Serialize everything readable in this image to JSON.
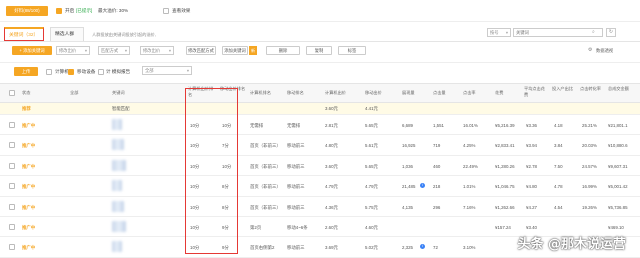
{
  "topbar": {
    "badge": "好料(88/100)",
    "enable_label": "开启",
    "enable_status": "[已提示]",
    "max_label": "最大溢价: 30%",
    "effect_label": "查看效果"
  },
  "tabs": [
    {
      "label": "关键词（32）",
      "active": true
    },
    {
      "label": "精选人群",
      "active": false
    }
  ],
  "tab_hint": "人群投放由关键词投放引起的溢价,",
  "search": {
    "scope": "按号",
    "placeholder": "关键词",
    "download_label": "数据透视"
  },
  "toolbar": {
    "add_keyword": "+ 添加关键词",
    "sel1": "修改出价",
    "sel2": "匹配方式",
    "sel3": "修改出价",
    "btn_smart": "修改匹配方式",
    "btn_add": "添加关键词",
    "btn_delete": "删除",
    "btn_copy": "复制",
    "btn_label": "标签"
  },
  "filters": {
    "upload": "上传",
    "compute": "计算机",
    "device": "移动设备",
    "period_label": "计 模拟报告",
    "period_value": "全部"
  },
  "headers": {
    "status": "状态",
    "all": "全部",
    "keyword": "关键词",
    "pc_rank": "计算机出价排名",
    "mobile_rank": "移动出价排名",
    "pc_match": "计算机排名",
    "mobile_match": "移动排名",
    "pc_bid": "计算机出价",
    "mobile_bid": "移动出价",
    "impressions": "展现量",
    "clicks": "点击量",
    "ctr": "点击率",
    "cost": "花费",
    "avg_cpc": "平均点击花费",
    "input_output": "投入产出比",
    "conv_rate": "点击转化率",
    "total_amount": "总成交金额"
  },
  "summary": {
    "status": "推荐",
    "match": "智能匹配",
    "pc_bid": "3.60元",
    "mobile_bid": "4.41元"
  },
  "rows": [
    {
      "status": "推广中",
      "pc_rank": "10分",
      "mobile_rank": "10分",
      "pc_match": "无需排",
      "mobile_match": "无需排",
      "pc_bid": "2.81元",
      "mobile_bid": "5.65元",
      "impressions": "6,689",
      "clicks": "1,551",
      "ctr": "16.01%",
      "cost": "¥5,216.39",
      "avg_cpc": "¥3.36",
      "roi": "4.18",
      "conv": "25.21%",
      "amount": "¥21,801.1",
      "info": false
    },
    {
      "status": "推广中",
      "pc_rank": "10分",
      "mobile_rank": "7分",
      "pc_match": "首页（非前三）",
      "mobile_match": "移动前三",
      "pc_bid": "4.80元",
      "mobile_bid": "5.61元",
      "impressions": "16,925",
      "clicks": "719",
      "ctr": "4.25%",
      "cost": "¥2,833.41",
      "avg_cpc": "¥3.94",
      "roi": "3.84",
      "conv": "20.03%",
      "amount": "¥10,880.6",
      "info": false
    },
    {
      "status": "推广中",
      "pc_rank": "10分",
      "mobile_rank": "10分",
      "pc_match": "首页（非前三）",
      "mobile_match": "移动前三",
      "pc_bid": "3.60元",
      "mobile_bid": "5.65元",
      "impressions": "1,036",
      "clicks": "460",
      "ctr": "22.49%",
      "cost": "¥1,280.26",
      "avg_cpc": "¥2.78",
      "roi": "7.50",
      "conv": "24.57%",
      "amount": "¥9,607.31",
      "info": false
    },
    {
      "status": "推广中",
      "pc_rank": "10分",
      "mobile_rank": "8分",
      "pc_match": "首页（非前三）",
      "mobile_match": "移动前三",
      "pc_bid": "4.79元",
      "mobile_bid": "4.79元",
      "impressions": "21,485",
      "clicks": "218",
      "ctr": "1.01%",
      "cost": "¥1,046.75",
      "avg_cpc": "¥4.80",
      "roi": "4.78",
      "conv": "16.99%",
      "amount": "¥5,001.42",
      "info": true
    },
    {
      "status": "推广中",
      "pc_rank": "10分",
      "mobile_rank": "8分",
      "pc_match": "首页（非前三）",
      "mobile_match": "移动前三",
      "pc_bid": "4.36元",
      "mobile_bid": "5.75元",
      "impressions": "4,135",
      "clicks": "296",
      "ctr": "7.16%",
      "cost": "¥1,262.66",
      "avg_cpc": "¥4.27",
      "roi": "4.54",
      "conv": "19.26%",
      "amount": "¥5,736.85",
      "info": false
    },
    {
      "status": "推广中",
      "pc_rank": "10分",
      "mobile_rank": "9分",
      "pc_match": "第2页",
      "mobile_match": "移动4~6条",
      "pc_bid": "2.60元",
      "mobile_bid": "4.60元",
      "impressions": "",
      "clicks": "",
      "ctr": "",
      "cost": "¥157.24",
      "avg_cpc": "¥3.40",
      "roi": "",
      "conv": "",
      "amount": "¥469.10",
      "info": false
    },
    {
      "status": "推广中",
      "pc_rank": "10分",
      "mobile_rank": "9分",
      "pc_match": "首页右侧第2",
      "mobile_match": "移动前三",
      "pc_bid": "3.69元",
      "mobile_bid": "5.02元",
      "impressions": "2,325",
      "clicks": "72",
      "ctr": "3.10%",
      "cost": "",
      "avg_cpc": "",
      "roi": "",
      "conv": "",
      "amount": "",
      "info": true
    }
  ],
  "watermark": "头条 @那木说运营"
}
